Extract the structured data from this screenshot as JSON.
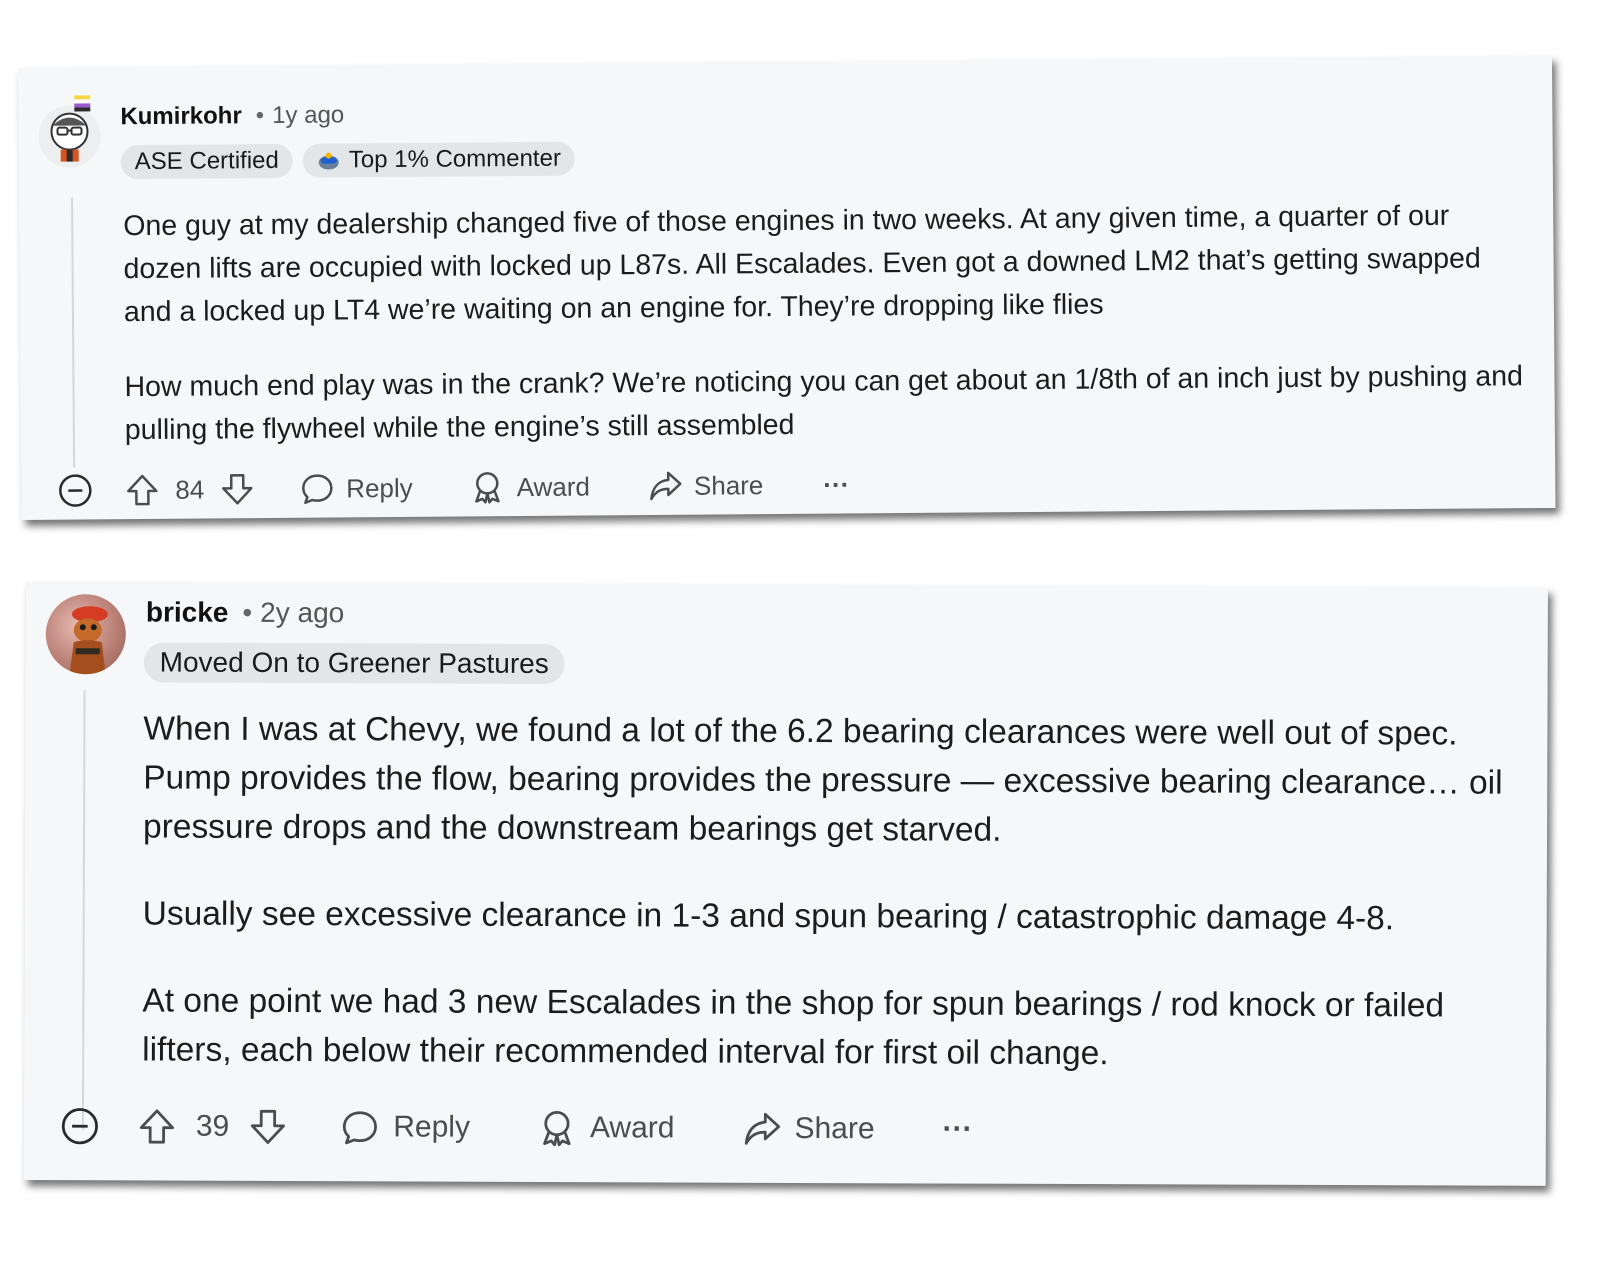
{
  "comments": [
    {
      "username": "Kumirkohr",
      "age": "1y ago",
      "flairs": [
        "ASE Certified",
        "Top 1% Commenter"
      ],
      "paragraphs": [
        "One guy at my dealership changed five of those engines in two weeks. At any given time, a quarter of our dozen lifts are occupied with locked up L87s. All Escalades. Even got a downed LM2 that’s getting swapped and a locked up LT4 we’re waiting on an engine for. They’re dropping like flies",
        "How much end play was in the crank? We’re noticing you can get about an 1/8th of an inch just by pushing and pulling the flywheel while the engine’s still assembled"
      ],
      "votes": "84",
      "actions": {
        "reply": "Reply",
        "award": "Award",
        "share": "Share",
        "more": "···"
      }
    },
    {
      "username": "bricke",
      "age": "2y ago",
      "flairs": [
        "Moved On to Greener Pastures"
      ],
      "paragraphs": [
        "When I was at Chevy, we found a lot of the 6.2 bearing clearances were well out of spec. Pump provides the flow, bearing provides the pressure — excessive bearing clearance… oil pressure drops and the downstream bearings get starved.",
        "Usually see excessive clearance in 1-3 and spun bearing / catastrophic damage 4-8.",
        "At one point we had 3 new Escalades in the shop for spun bearings / rod knock or failed lifters, each below their recommended interval for first oil change."
      ],
      "votes": "39",
      "actions": {
        "reply": "Reply",
        "award": "Award",
        "share": "Share",
        "more": "···"
      }
    }
  ],
  "header": {
    "separator": "•"
  },
  "colors": {
    "card_bg": "#f6f7f8",
    "flair_bg": "#e3e6e9",
    "action_text": "#4a4d50"
  },
  "icons": [
    "collapse-icon",
    "upvote-icon",
    "downvote-icon",
    "reply-icon",
    "award-icon",
    "share-icon",
    "top-commenter-icon"
  ]
}
